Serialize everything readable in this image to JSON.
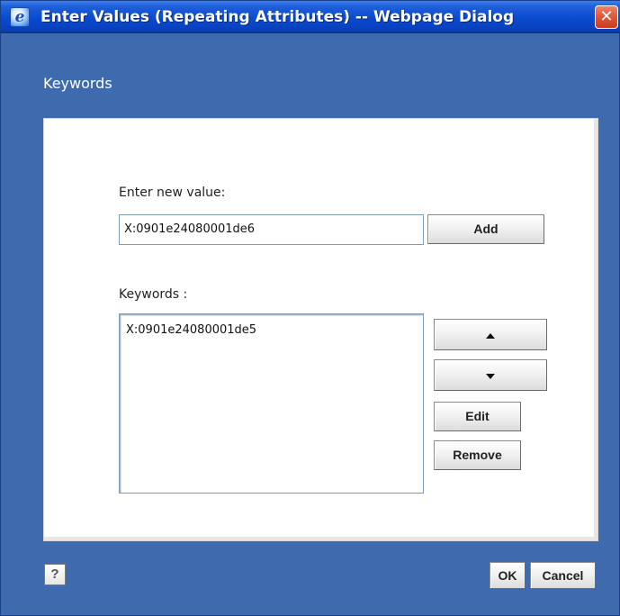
{
  "window": {
    "title": "Enter Values (Repeating Attributes) -- Webpage Dialog",
    "icon": "ie-icon",
    "close_glyph": "✕"
  },
  "dialog": {
    "section_title": "Keywords"
  },
  "new_value": {
    "label": "Enter new value:",
    "input_value": "X:0901e24080001de6",
    "add_label": "Add"
  },
  "keywords": {
    "label": "Keywords :",
    "items": [
      "X:0901e24080001de5"
    ]
  },
  "side_buttons": {
    "up_icon": "arrow-up-icon",
    "down_icon": "arrow-down-icon",
    "edit_label": "Edit",
    "remove_label": "Remove"
  },
  "footer": {
    "help_glyph": "?",
    "ok_label": "OK",
    "cancel_label": "Cancel"
  },
  "colors": {
    "dialog_background": "#3d6bae",
    "titlebar": "#0a4ad0",
    "close_button": "#e05a3c"
  }
}
